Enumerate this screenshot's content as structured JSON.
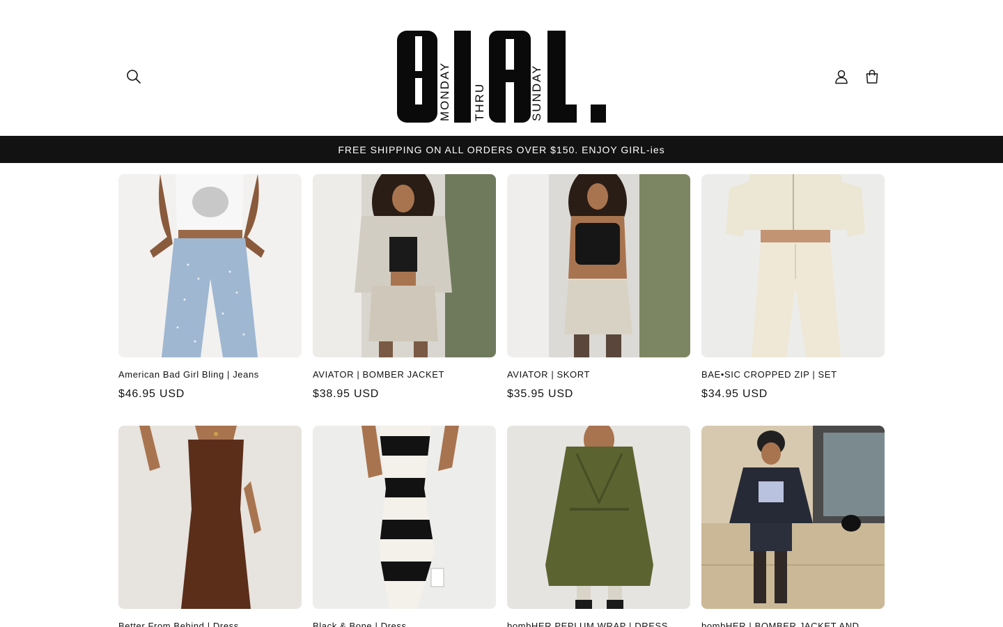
{
  "header": {
    "logo": {
      "letters": "GIRL.",
      "words": [
        "MONDAY",
        "THRU",
        "SUNDAY"
      ]
    },
    "icons": {
      "search": "search-icon",
      "account": "user-icon",
      "cart": "bag-icon"
    }
  },
  "announcement": {
    "text": "FREE SHIPPING ON ALL ORDERS OVER $150. ENJOY GIRL-ies"
  },
  "products": [
    {
      "title": "American Bad Girl Bling | Jeans",
      "price": "$46.95 USD"
    },
    {
      "title": "AVIATOR | BOMBER JACKET",
      "price": "$38.95 USD"
    },
    {
      "title": "AVIATOR | SKORT",
      "price": "$35.95 USD"
    },
    {
      "title": "BAE•SIC CROPPED ZIP | SET",
      "price": "$34.95 USD"
    },
    {
      "title": "Better From Behind | Dress",
      "price": ""
    },
    {
      "title": "Black & Bone | Dress",
      "price": ""
    },
    {
      "title": "bombHER PEPLUM WRAP | DRESS",
      "price": ""
    },
    {
      "title": "bombHER | BOMBER JACKET AND",
      "price": ""
    }
  ]
}
